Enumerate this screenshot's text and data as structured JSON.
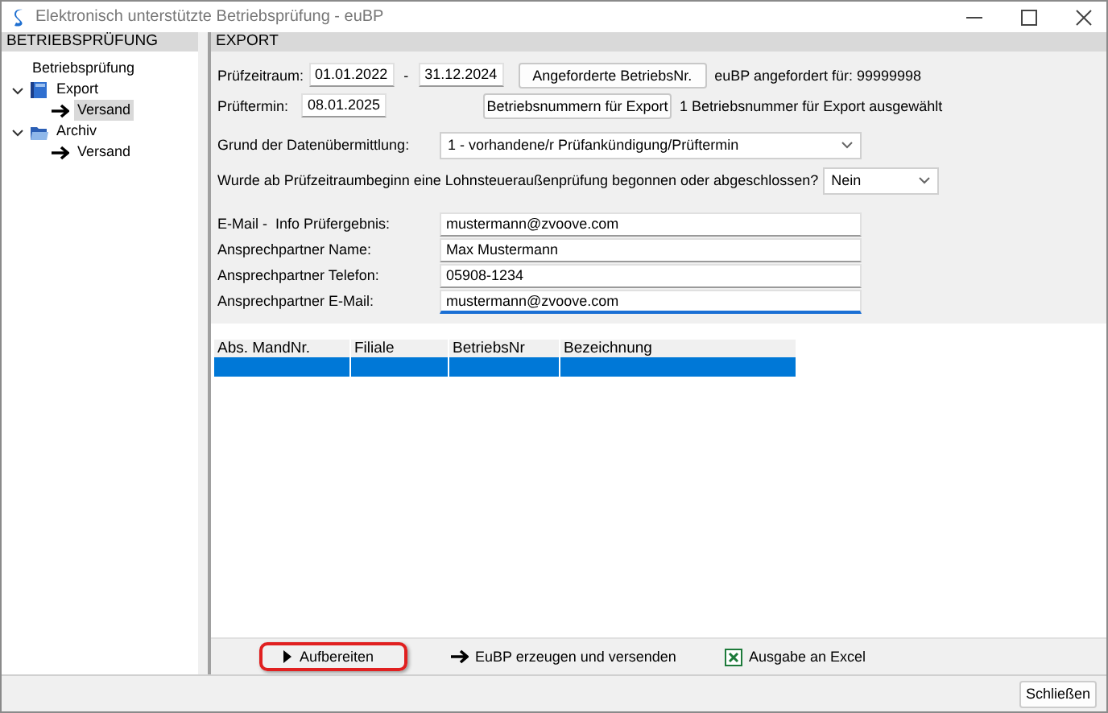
{
  "window": {
    "title": "Elektronisch unterstützte Betriebsprüfung - euBP"
  },
  "sidebar": {
    "header": "BETRIEBSPRÜFUNG",
    "items": [
      {
        "label": "Betriebsprüfung",
        "kind": "plain",
        "selected": false
      },
      {
        "label": "Export",
        "kind": "book",
        "expanded": true,
        "selected": false,
        "children": [
          {
            "label": "Versand",
            "kind": "arrow",
            "selected": true
          }
        ]
      },
      {
        "label": "Archiv",
        "kind": "folder",
        "expanded": true,
        "selected": false,
        "children": [
          {
            "label": "Versand",
            "kind": "arrow",
            "selected": false
          }
        ]
      }
    ]
  },
  "export": {
    "header": "EXPORT",
    "period": {
      "label": "Prüfzeitraum:",
      "from": "01.01.2022",
      "separator": "-",
      "to": "31.12.2024",
      "button": "Angeforderte BetriebsNr.",
      "info": "euBP angefordert für: 99999998"
    },
    "date": {
      "label": "Prüftermin:",
      "value": "08.01.2025",
      "button": "Betriebsnummern für Export",
      "info": "1 Betriebsnummer für Export ausgewählt"
    },
    "reason": {
      "label": "Grund der Datenübermittlung:",
      "value": "1 - vorhandene/r Prüfankündigung/Prüftermin"
    },
    "question": {
      "label": "Wurde ab Prüfzeitraumbeginn eine Lohnsteueraußenprüfung begonnen oder abgeschlossen?",
      "value": "Nein"
    },
    "contacts": [
      {
        "label": "E-Mail -  Info Prüfergebnis:",
        "value": "mustermann@zvoove.com",
        "focused": false
      },
      {
        "label": "Ansprechpartner Name:",
        "value": "Max Mustermann",
        "focused": false
      },
      {
        "label": "Ansprechpartner Telefon:",
        "value": "05908-1234",
        "focused": false
      },
      {
        "label": "Ansprechpartner E-Mail:",
        "value": "mustermann@zvoove.com",
        "focused": true
      }
    ],
    "table": {
      "columns": [
        "Abs. MandNr.",
        "Filiale",
        "BetriebsNr",
        "Bezeichnung"
      ],
      "rows": [
        {
          "selected": true
        }
      ]
    },
    "actions": [
      {
        "label": "Aufbereiten",
        "kind": "play",
        "highlighted": true
      },
      {
        "label": "EuBP erzeugen und versenden",
        "kind": "arrow",
        "highlighted": false
      },
      {
        "label": "Ausgabe an Excel",
        "kind": "excel",
        "highlighted": false
      }
    ]
  },
  "footer": {
    "close_button": "Schließen"
  }
}
